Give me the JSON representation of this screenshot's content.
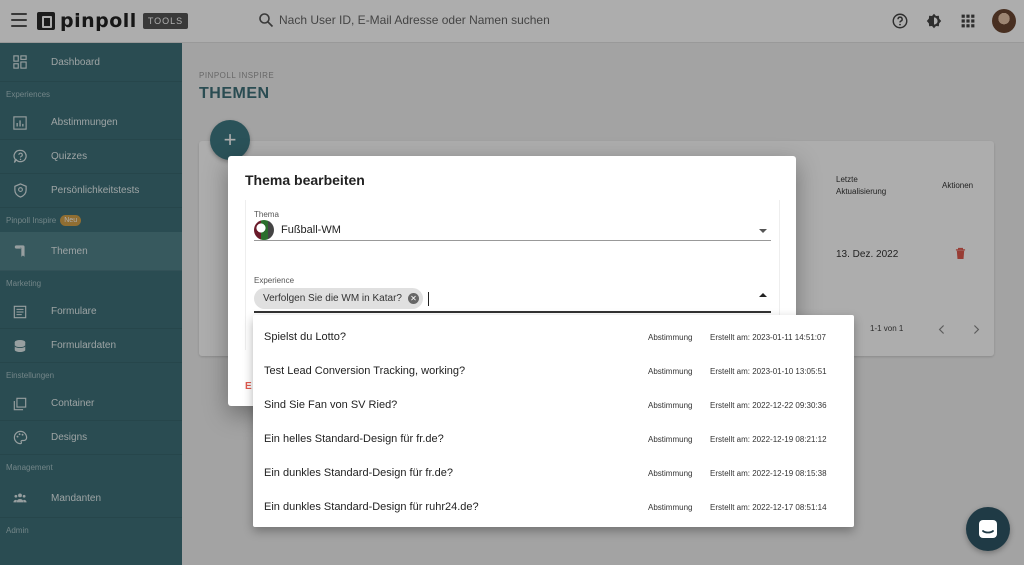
{
  "app": {
    "logo_text": "pinpoll",
    "logo_badge": "TOOLS"
  },
  "search": {
    "placeholder": "Nach User ID, E-Mail Adresse oder Namen suchen"
  },
  "topbar_icons": [
    "help-icon",
    "theme-icon",
    "apps-grid-icon",
    "user-avatar"
  ],
  "sidebar": {
    "items": [
      {
        "type": "item",
        "label": "Dashboard",
        "icon": "dashboard-icon"
      },
      {
        "type": "section",
        "label": "Experiences"
      },
      {
        "type": "item",
        "label": "Abstimmungen",
        "icon": "poll-chart-icon"
      },
      {
        "type": "item",
        "label": "Quizzes",
        "icon": "quiz-question-icon"
      },
      {
        "type": "item",
        "label": "Persönlichkeitstests",
        "icon": "personality-test-icon"
      },
      {
        "type": "section",
        "label": "Pinpoll Inspire",
        "badge": "Neu"
      },
      {
        "type": "item",
        "label": "Themen",
        "icon": "bookmark-icon",
        "active": true
      },
      {
        "type": "section",
        "label": "Marketing"
      },
      {
        "type": "item",
        "label": "Formulare",
        "icon": "form-icon"
      },
      {
        "type": "item",
        "label": "Formulardaten",
        "icon": "database-icon"
      },
      {
        "type": "section",
        "label": "Einstellungen"
      },
      {
        "type": "item",
        "label": "Container",
        "icon": "container-icon"
      },
      {
        "type": "item",
        "label": "Designs",
        "icon": "palette-icon"
      },
      {
        "type": "section",
        "label": "Management"
      },
      {
        "type": "item",
        "label": "Mandanten",
        "icon": "people-icon"
      },
      {
        "type": "section",
        "label": "Admin"
      }
    ]
  },
  "page": {
    "breadcrumb": "PINPOLL INSPIRE",
    "title": "THEMEN"
  },
  "table": {
    "col_updated_line1": "Letzte",
    "col_updated_line2": "Aktualisierung",
    "col_actions": "Aktionen",
    "row_date": "13. Dez. 2022",
    "pagination": "1-1 von 1"
  },
  "dialog": {
    "title": "Thema bearbeiten",
    "thema_label": "Thema",
    "thema_value": "Fußball-WM",
    "experience_label": "Experience",
    "chip_label": "Verfolgen Sie die WM in Katar?",
    "footer_partial": "E"
  },
  "options": [
    {
      "name": "Spielst du Lotto?",
      "type": "Abstimmung",
      "created": "Erstellt am: 2023-01-11 14:51:07"
    },
    {
      "name": "Test Lead Conversion Tracking, working?",
      "type": "Abstimmung",
      "created": "Erstellt am: 2023-01-10 13:05:51"
    },
    {
      "name": "Sind Sie Fan von SV Ried?",
      "type": "Abstimmung",
      "created": "Erstellt am: 2022-12-22 09:30:36"
    },
    {
      "name": "Ein helles Standard-Design für fr.de?",
      "type": "Abstimmung",
      "created": "Erstellt am: 2022-12-19 08:21:12"
    },
    {
      "name": "Ein dunkles Standard-Design für fr.de?",
      "type": "Abstimmung",
      "created": "Erstellt am: 2022-12-19 08:15:38"
    },
    {
      "name": "Ein dunkles Standard-Design für ruhr24.de?",
      "type": "Abstimmung",
      "created": "Erstellt am: 2022-12-17 08:51:14"
    }
  ],
  "colors": {
    "sidebar": "#3e7079",
    "accent": "#3e7a84",
    "danger": "#e05a4e"
  }
}
